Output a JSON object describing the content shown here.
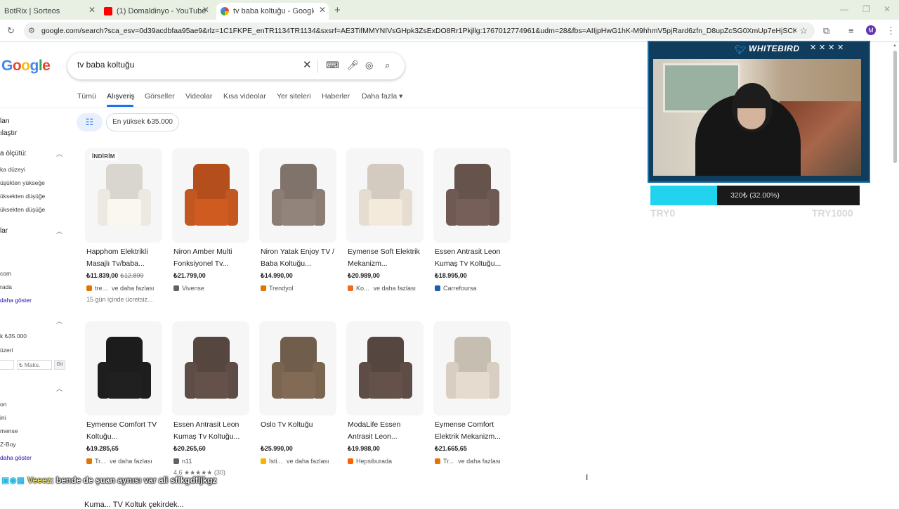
{
  "tabs": [
    {
      "title": "BotRix | Sorteos",
      "favicon_color": "#9e9e9e"
    },
    {
      "title": "(1) Domaldinyo - YouTube",
      "favicon_color": "#ff0000"
    },
    {
      "title": "tv baba koltuğu - Google Alışveriş",
      "favicon_color": "#4285f4"
    }
  ],
  "new_tab": "+",
  "window_controls": {
    "minimize": "—",
    "maximize": "❐",
    "close": "✕"
  },
  "address": {
    "url": "google.com/search?sca_esv=0d39acdbfaa95ae9&rlz=1C1FKPE_enTR1134TR1134&sxsrf=AE3TifMMYNIVsGHpk3ZsExDO8Rr1Pkjllg:1767012774961&udm=28&fbs=AIIjpHwG1hK-M9hhmV5pjRard6zfn_D8upZcSG0XmUp7eHjSCKeS1MI6Tw_SPxQCTCam..."
  },
  "profile_initial": "M",
  "google": {
    "logo": [
      "G",
      "o",
      "o",
      "g",
      "l",
      "e"
    ],
    "query": "tv baba koltuğu",
    "tabs": [
      "Tümü",
      "Alışveriş",
      "Görseller",
      "Videolar",
      "Kısa videolar",
      "Yer siteleri",
      "Haberler",
      "Daha fazla ▾"
    ],
    "price_chip": "En yüksek ₺35.000"
  },
  "sidebar": {
    "lines": [
      "ları",
      "ılaştır",
      "a ölçütü:",
      "ka düzeyi",
      "üşükten yükseğe",
      "üksekten düşüğe",
      "üksekten düşüğe",
      "lar",
      "com",
      "rada",
      "daha göster",
      "k ₺35.000",
      "üzeri",
      "on",
      "ini",
      "mense",
      "Z-Boy",
      "daha göster"
    ],
    "max_placeholder": "₺ Maks.",
    "go": "Git"
  },
  "products": [
    {
      "title": "Happhom Elektrikli Masajlı Tv/baba...",
      "price": "₺11.839,00",
      "old_price": "₺12.899",
      "seller": "tre...",
      "more": "ve daha fazlası",
      "extra": "15 gün içinde ücretsiz...",
      "badge": "İNDİRİM",
      "seller_color": "#e37400",
      "chair_color": "#ece9e2"
    },
    {
      "title": "Niron Amber Multi Fonksiyonel Tv...",
      "price": "₺21.799,00",
      "old_price": "",
      "seller": "Vivense",
      "more": "",
      "extra": "",
      "badge": "",
      "seller_color": "#5f6368",
      "chair_color": "#c4561f"
    },
    {
      "title": "Niron Yatak Enjoy TV / Baba Koltuğu...",
      "price": "₺14.990,00",
      "old_price": "",
      "seller": "Trendyol",
      "more": "",
      "extra": "",
      "badge": "",
      "seller_color": "#e37400",
      "chair_color": "#8b7d74"
    },
    {
      "title": "Eymense Soft Elektrik Mekanizm...",
      "price": "₺20.989,00",
      "old_price": "",
      "seller": "Ko...",
      "more": "ve daha fazlası",
      "extra": "",
      "badge": "",
      "seller_color": "#f36b22",
      "chair_color": "#e5ddd0"
    },
    {
      "title": "Essen Antrasit Leon Kumaş Tv Koltuğu...",
      "price": "₺18.995,00",
      "old_price": "",
      "seller": "Carrefoursa",
      "more": "",
      "extra": "",
      "badge": "",
      "seller_color": "#1b5fb1",
      "chair_color": "#6f5a53"
    },
    {
      "title": "Eymense Comfort TV Koltuğu...",
      "price": "₺19.285,65",
      "old_price": "",
      "seller": "Tr...",
      "more": "ve daha fazlası",
      "extra": "",
      "badge": "",
      "seller_color": "#e37400",
      "chair_color": "#1e1e1e"
    },
    {
      "title": "Essen Antrasit Leon Kumaş Tv Koltuğu...",
      "price": "₺20.265,60",
      "old_price": "",
      "seller": "n11",
      "more": "",
      "extra": "4,6 ★★★★★ (30)",
      "badge": "",
      "seller_color": "#5f6368",
      "chair_color": "#5e4c46"
    },
    {
      "title": "Oslo Tv Koltuğu",
      "price": "₺25.990,00",
      "old_price": "",
      "seller": "İsti...",
      "more": "ve daha fazlası",
      "extra": "",
      "badge": "",
      "seller_color": "#f4b400",
      "chair_color": "#7a6551"
    },
    {
      "title": "ModaLife Essen Antrasit Leon...",
      "price": "₺19.988,00",
      "old_price": "",
      "seller": "Hepsiburada",
      "more": "",
      "extra": "",
      "badge": "",
      "seller_color": "#ff6000",
      "chair_color": "#5e4c46"
    },
    {
      "title": "Eymense Comfort Elektrik Mekanizm...",
      "price": "₺21.665,65",
      "old_price": "",
      "seller": "Tr...",
      "more": "ve daha fazlası",
      "extra": "",
      "badge": "",
      "seller_color": "#e37400",
      "chair_color": "#d8cfc2"
    }
  ],
  "overlay": {
    "brand": "WHITEBIRD",
    "x_marks": [
      "✕",
      "✕",
      "✕",
      "✕"
    ],
    "progress_fraction": 0.32,
    "progress_label": "320₺ (32.00%)",
    "min_label": "TRY0",
    "max_label": "TRY1000",
    "fill_color": "#22d3ee"
  },
  "chat": {
    "badges": "▣◉▦",
    "user": "Veeez",
    "message": ": bende de şuan aynısı var ali sflkgdfljkgz"
  },
  "bottom_text": "Kuma...  TV Koltuk çekirdek..."
}
